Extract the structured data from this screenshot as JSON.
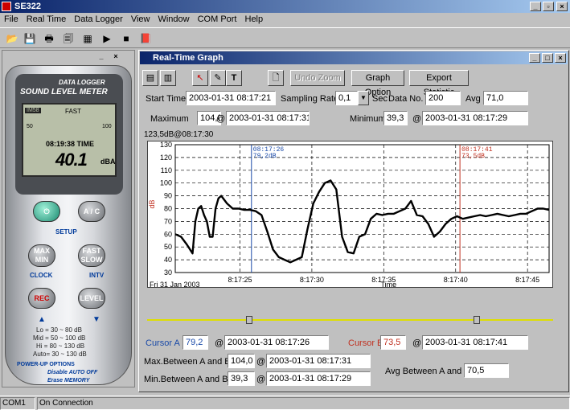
{
  "app": {
    "title": "SE322"
  },
  "menu": [
    "File",
    "Real Time",
    "Data Logger",
    "View",
    "Window",
    "COM Port",
    "Help"
  ],
  "meter": {
    "brand_line1": "DATA LOGGER",
    "brand_line2": "SOUND LEVEL METER",
    "lcd_badge": "IM58",
    "lcd_fast": "FAST",
    "lcd_50": "50",
    "lcd_100": "100",
    "lcd_time": "08:19:38 TIME",
    "lcd_value": "40.1",
    "lcd_unit": "dBA",
    "btn_power": "⏻",
    "btn_ac": "A / C",
    "setup_label": "SETUP",
    "btn_maxmin": "MAX MIN",
    "btn_fastslow": "FAST SLOW",
    "clock_label": "CLOCK",
    "intv_label": "INTV",
    "btn_rec": "REC",
    "btn_level": "LEVEL",
    "ranges": [
      "Lo = 30 ~ 80 dB",
      "Mid = 50 ~ 100 dB",
      "Hi = 80 ~ 130 dB",
      "Auto= 30 ~ 130 dB"
    ],
    "powerup_title": "POWER-UP OPTIONS",
    "powerup_1": "Disable AUTO OFF",
    "powerup_2": "Erase MEMORY"
  },
  "graph_window": {
    "title": "Real-Time Graph",
    "undo_zoom": "Undo Zoom",
    "graph_option": "Graph Option",
    "export_statistic": "Export Statistic",
    "start_time_label": "Start Time",
    "start_time": "2003-01-31 08:17:21",
    "sampling_rate_label": "Sampling Rate",
    "sampling_rate": "0,1",
    "sec_label": "Sec",
    "data_no_label": "Data No.",
    "data_no": "200",
    "avg_label": "Avg",
    "avg": "71,0",
    "maximum_label": "Maximum",
    "maximum": "104,0",
    "max_at": "2003-01-31 08:17:31",
    "minimum_label": "Minimum",
    "minimum": "39,3",
    "min_at": "2003-01-31 08:17:29",
    "at": "@",
    "peak_label": "123,5dB@08:17:30",
    "cursor_a_label": "Cursor A",
    "cursor_a_value": "79,2",
    "cursor_a_time": "2003-01-31 08:17:26",
    "cursor_b_label": "Cursor B",
    "cursor_b_value": "73,5",
    "cursor_b_time": "2003-01-31 08:17:41",
    "maxab_label": "Max.Between A and B",
    "maxab_value": "104,0",
    "maxab_time": "2003-01-31 08:17:31",
    "minab_label": "Min.Between A and B",
    "minab_value": "39,3",
    "minab_time": "2003-01-31 08:17:29",
    "avgab_label": "Avg Between A and B",
    "avgab_value": "70,5"
  },
  "chart_data": {
    "type": "line",
    "ylabel": "dB",
    "xlabel": "Time",
    "date_label": "Fri 31 Jan 2003",
    "ylim": [
      30,
      130
    ],
    "yticks": [
      30,
      40,
      50,
      60,
      70,
      80,
      90,
      100,
      110,
      120,
      130
    ],
    "xlim_seconds": [
      21,
      47
    ],
    "xticks": [
      "8:17:25",
      "8:17:30",
      "8:17:35",
      "8:17:40",
      "8:17:45"
    ],
    "cursor_a": {
      "time": "08:17:26",
      "value": "79,2dB",
      "x_seconds": 26.3
    },
    "cursor_b": {
      "time": "08:17:41",
      "value": "73,5dB",
      "x_seconds": 40.8
    },
    "x_seconds": [
      21,
      21.4,
      21.8,
      22.2,
      22.4,
      22.6,
      22.8,
      23.0,
      23.2,
      23.4,
      23.6,
      23.8,
      24.0,
      24.2,
      24.6,
      25.0,
      25.4,
      25.8,
      26.2,
      26.6,
      27.0,
      27.4,
      27.8,
      28.2,
      28.6,
      29.0,
      29.4,
      29.8,
      30.2,
      30.6,
      31.0,
      31.4,
      31.8,
      32.2,
      32.6,
      33.0,
      33.4,
      33.8,
      34.2,
      34.6,
      35.0,
      35.4,
      35.8,
      36.2,
      36.6,
      37.0,
      37.4,
      37.8,
      38.2,
      38.6,
      39.0,
      39.4,
      39.8,
      40.2,
      40.6,
      41.0,
      41.4,
      41.8,
      42.2,
      42.6,
      43.0,
      43.4,
      43.8,
      44.2,
      44.6,
      45.0,
      45.4,
      45.8,
      46.2,
      46.6,
      47.0
    ],
    "values": [
      60,
      58,
      52,
      45,
      70,
      80,
      82,
      75,
      70,
      58,
      58,
      80,
      88,
      90,
      84,
      80,
      80,
      79,
      79,
      78,
      75,
      62,
      48,
      42,
      40,
      38,
      40,
      42,
      64,
      84,
      93,
      100,
      102,
      95,
      58,
      46,
      45,
      58,
      60,
      72,
      76,
      75,
      76,
      76,
      78,
      80,
      86,
      75,
      74,
      68,
      58,
      62,
      68,
      72,
      74,
      72,
      73,
      74,
      75,
      74,
      75,
      76,
      75,
      74,
      75,
      76,
      76,
      78,
      80,
      80,
      79
    ]
  }
}
